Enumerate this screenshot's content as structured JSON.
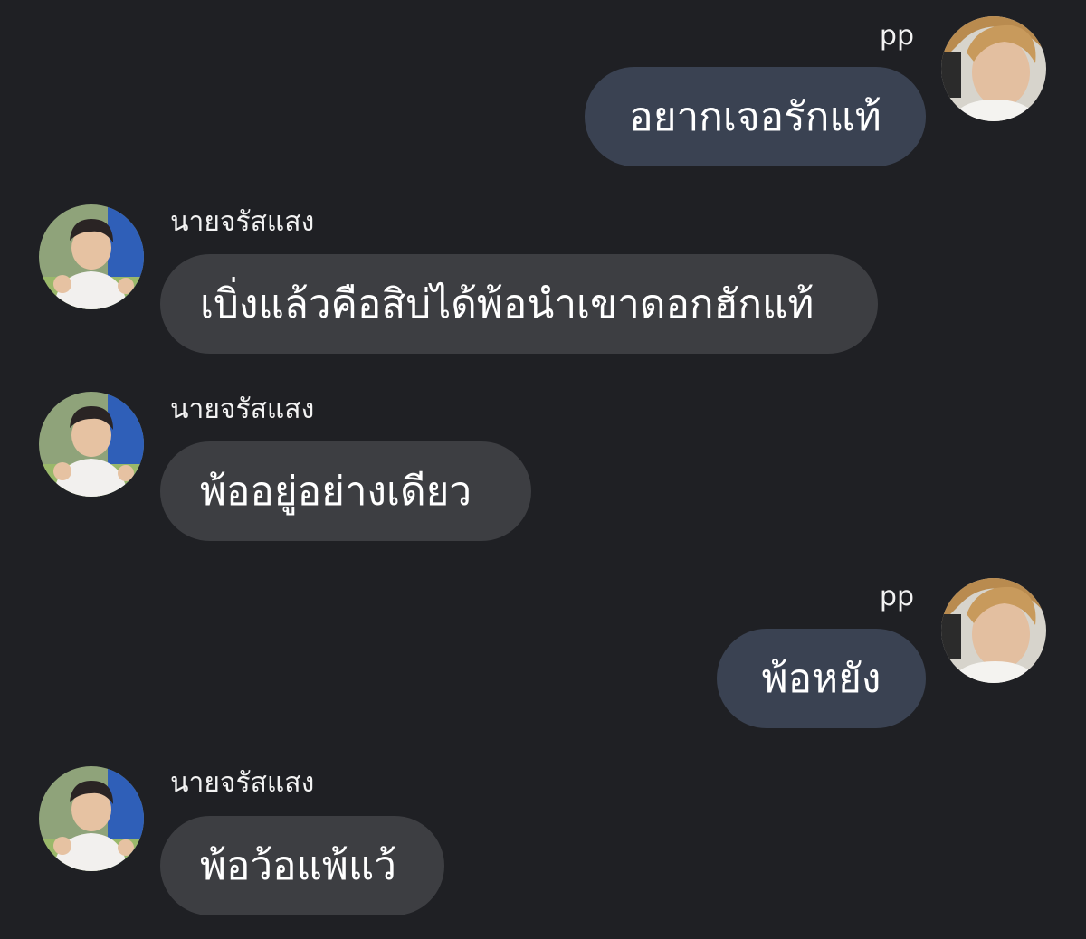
{
  "conversation": {
    "messages": [
      {
        "sender": "pp",
        "text": "อยากเจอรักแท้"
      },
      {
        "sender": "นายจรัสแสง",
        "text": "เบิ่งแล้วคือสิบ่ได้พ้อนำเขาดอกฮักแท้"
      },
      {
        "sender": "นายจรัสแสง",
        "text": "พ้ออยู่อย่างเดียว"
      },
      {
        "sender": "pp",
        "text": "พ้อหยัง"
      },
      {
        "sender": "นายจรัสแสง",
        "text": "พ้อว้อแพ้แว้"
      }
    ]
  }
}
